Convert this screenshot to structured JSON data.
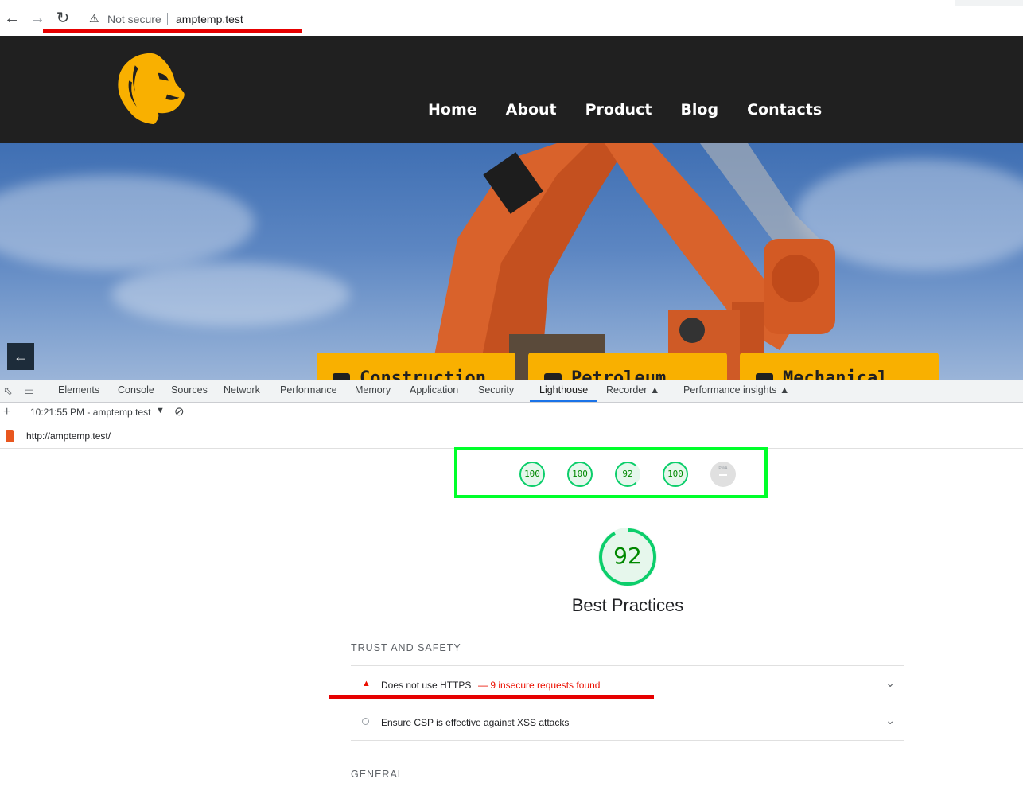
{
  "browser": {
    "security_label": "Not secure",
    "url": "amptemp.test",
    "icons": [
      "back-arrow-icon",
      "forward-arrow-icon",
      "reload-icon",
      "warning-icon"
    ]
  },
  "site": {
    "nav": [
      "Home",
      "About",
      "Product",
      "Blog",
      "Contacts"
    ],
    "services": [
      "Construction",
      "Petroleum",
      "Mechanical"
    ],
    "colors": {
      "header_bg": "#202020",
      "accent": "#f9b000"
    }
  },
  "devtools": {
    "tabs": [
      "Elements",
      "Console",
      "Sources",
      "Network",
      "Performance",
      "Memory",
      "Application",
      "Security",
      "Lighthouse",
      "Recorder",
      "Performance insights"
    ],
    "active_tab": "Lighthouse",
    "report_selector": "10:21:55 PM - amptemp.test",
    "report_url": "http://amptemp.test/"
  },
  "lighthouse": {
    "scores": [
      "100",
      "100",
      "92",
      "100"
    ],
    "pwa_label": "PWA",
    "category_score": "92",
    "category_score_value": 92,
    "category_title": "Best Practices",
    "groups": {
      "trust_title": "TRUST AND SAFETY",
      "general_title": "GENERAL"
    },
    "audits": [
      {
        "label": "Does not use HTTPS",
        "detail": "— 9 insecure requests found",
        "status": "fail"
      },
      {
        "label": "Ensure CSP is effective against XSS attacks",
        "detail": "",
        "status": "info"
      }
    ],
    "colors": {
      "pass": "#0cce6b",
      "fail": "#eb0f00",
      "highlight": "#00ff2a"
    }
  }
}
